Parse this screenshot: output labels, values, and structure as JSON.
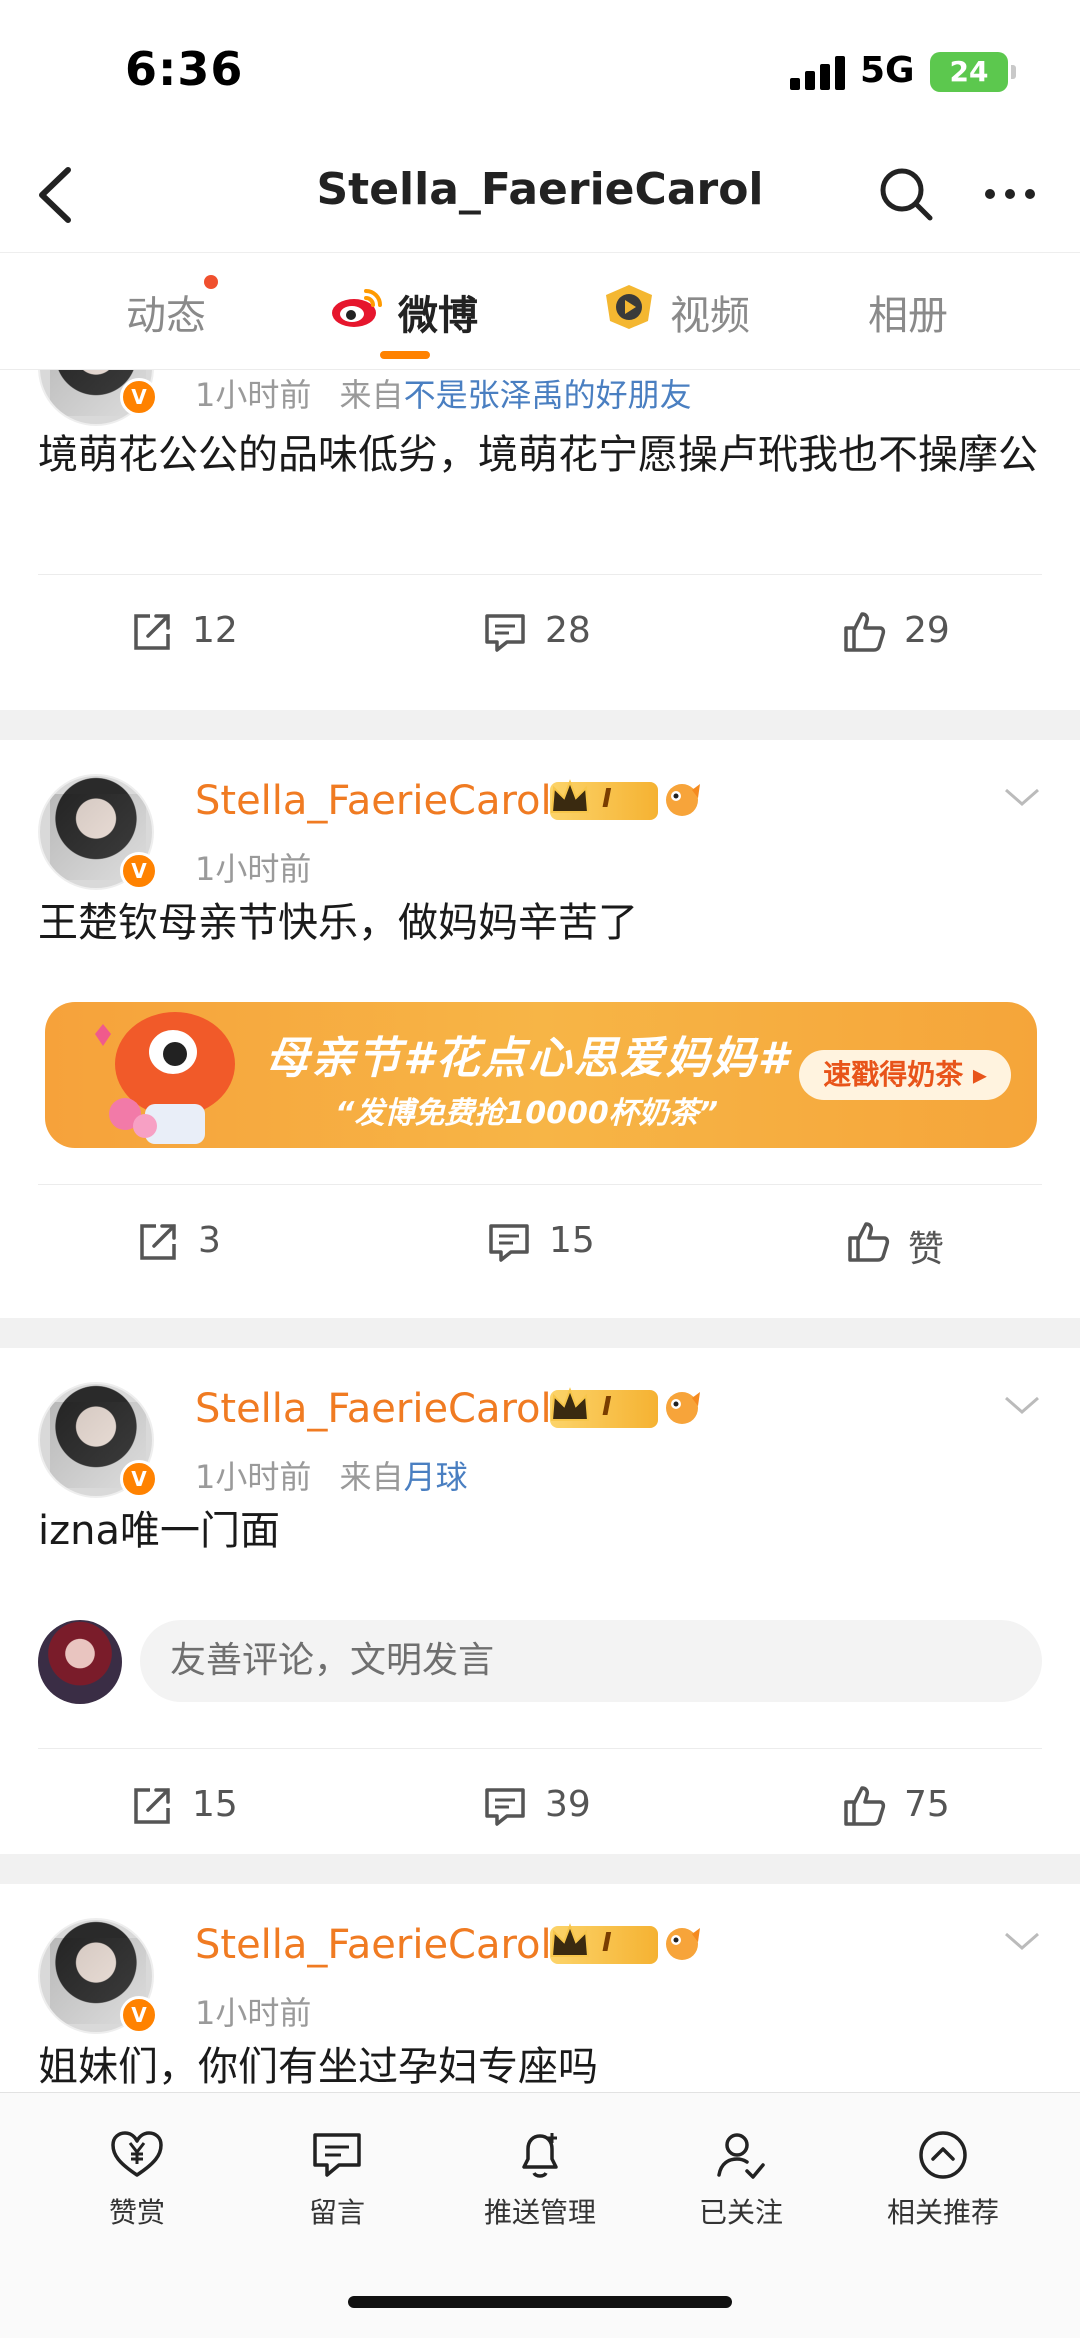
{
  "status_bar": {
    "time": "6:36",
    "network": "5G",
    "battery": "24"
  },
  "nav": {
    "title": "Stella_FaerieCarol"
  },
  "tabs": [
    {
      "label": "动态"
    },
    {
      "label": "微博"
    },
    {
      "label": "视频"
    },
    {
      "label": "相册"
    }
  ],
  "posts": [
    {
      "time": "1小时前",
      "source_prefix": "来自",
      "source": "不是张泽禹的好朋友",
      "text": "境萌花公公的品味低劣，境萌花宁愿操卢玳我也不操摩公",
      "reposts": "12",
      "comments": "28",
      "likes": "29"
    },
    {
      "username": "Stella_FaerieCarol",
      "level": "I",
      "time": "1小时前",
      "text": "王楚钦母亲节快乐，做妈妈辛苦了",
      "banner": {
        "title": "母亲节#花点心思爱妈妈#",
        "subtitle": "“发博免费抢10000杯奶茶”",
        "cta": "速戳得奶茶 ▸"
      },
      "reposts": "3",
      "comments": "15",
      "likes": "赞"
    },
    {
      "username": "Stella_FaerieCarol",
      "level": "I",
      "time": "1小时前",
      "source_prefix": "来自",
      "source": "月球",
      "text": "izna唯一门面",
      "comment_placeholder": "友善评论，文明发言",
      "reposts": "15",
      "comments": "39",
      "likes": "75"
    },
    {
      "username": "Stella_FaerieCarol",
      "level": "I",
      "time": "1小时前",
      "text": "姐妹们，你们有坐过孕妇专座吗"
    }
  ],
  "bottom_bar": [
    {
      "label": "赞赏",
      "icon": "heart-yen-icon"
    },
    {
      "label": "留言",
      "icon": "message-icon"
    },
    {
      "label": "推送管理",
      "icon": "bell-plus-icon"
    },
    {
      "label": "已关注",
      "icon": "person-check-icon"
    },
    {
      "label": "相关推荐",
      "icon": "chevron-up-circle-icon"
    }
  ],
  "colors": {
    "accent": "#ff8200",
    "username": "#f07b22",
    "link": "#4a7fc1"
  }
}
